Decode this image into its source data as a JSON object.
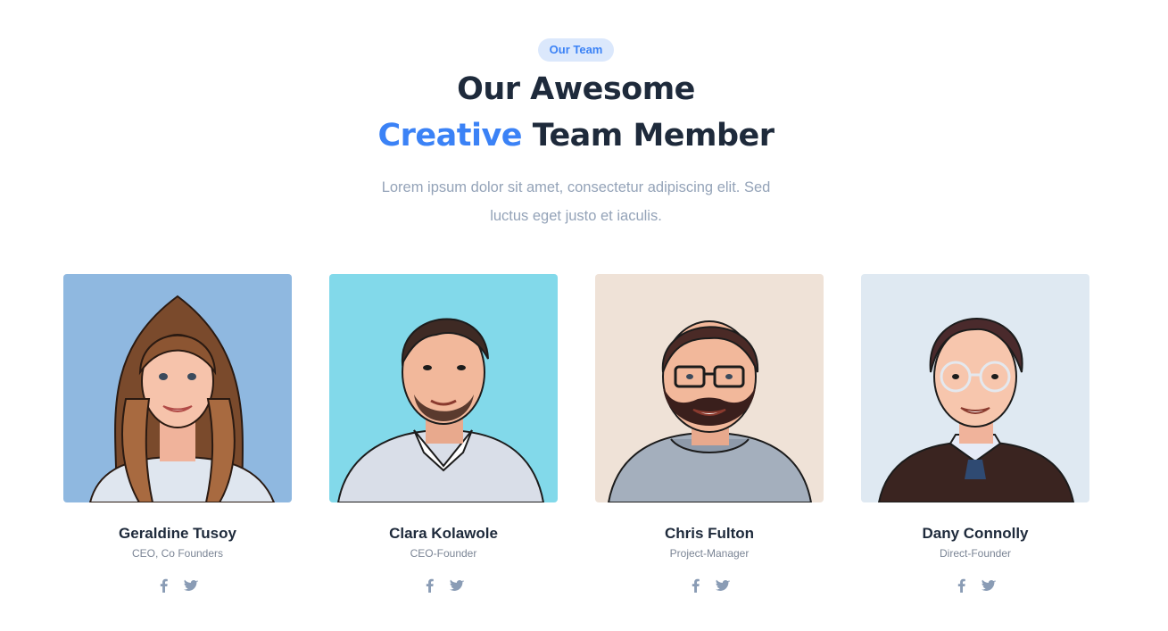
{
  "header": {
    "badge": "Our Team",
    "title_line1": "Our Awesome",
    "title_accent": "Creative",
    "title_rest": " Team Member",
    "description_line1": "Lorem ipsum dolor sit amet, consectetur adipiscing elit. Sed",
    "description_line2": "luctus eget justo et iaculis."
  },
  "colors": {
    "accent": "#3b82f6",
    "heading": "#1e2a3b",
    "muted": "#94a3b8",
    "social_icon": "#8a9cb5"
  },
  "team": [
    {
      "name": "Geraldine Tusoy",
      "role": "CEO, Co Founders",
      "photo_bg": "#8fb8e0",
      "icons": [
        "facebook-icon",
        "twitter-icon"
      ]
    },
    {
      "name": "Clara Kolawole",
      "role": "CEO-Founder",
      "photo_bg": "#82d9ea",
      "icons": [
        "facebook-icon",
        "twitter-icon"
      ]
    },
    {
      "name": "Chris Fulton",
      "role": "Project-Manager",
      "photo_bg": "#efe2d7",
      "icons": [
        "facebook-icon",
        "twitter-icon"
      ]
    },
    {
      "name": "Dany Connolly",
      "role": "Direct-Founder",
      "photo_bg": "#dfe9f2",
      "icons": [
        "facebook-icon",
        "twitter-icon"
      ]
    }
  ]
}
